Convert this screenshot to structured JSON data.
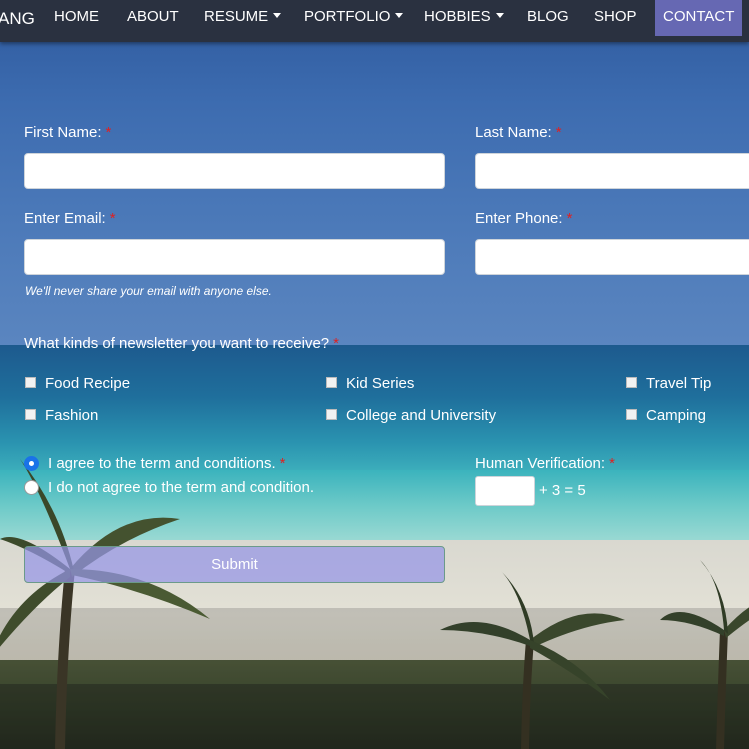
{
  "nav": {
    "brand": "ANG",
    "items": [
      {
        "label": "HOME",
        "dropdown": false,
        "active": false
      },
      {
        "label": "ABOUT",
        "dropdown": false,
        "active": false
      },
      {
        "label": "RESUME",
        "dropdown": true,
        "active": false
      },
      {
        "label": "PORTFOLIO",
        "dropdown": true,
        "active": false
      },
      {
        "label": "HOBBIES",
        "dropdown": true,
        "active": false
      },
      {
        "label": "BLOG",
        "dropdown": false,
        "active": false
      },
      {
        "label": "SHOP",
        "dropdown": false,
        "active": false
      },
      {
        "label": "CONTACT",
        "dropdown": false,
        "active": true
      }
    ],
    "active_color": "#6668b3"
  },
  "form": {
    "first_name": {
      "label": "First Name:",
      "required": "*",
      "value": ""
    },
    "last_name": {
      "label": "Last Name:",
      "required": "*",
      "value": ""
    },
    "email": {
      "label": "Enter Email:",
      "required": "*",
      "value": "",
      "help": "We'll never share your email with anyone else."
    },
    "phone": {
      "label": "Enter Phone:",
      "required": "*",
      "value": ""
    },
    "newsletter": {
      "question": "What kinds of newsletter you want to receive?",
      "required": "*",
      "options": [
        "Food Recipe",
        "Kid Series",
        "Travel Tip",
        "Fashion",
        "College and University",
        "Camping"
      ]
    },
    "terms": {
      "agree": "I agree to the term and conditions.",
      "agree_required": "*",
      "disagree": "I do not agree to the term and condition.",
      "selected": "agree"
    },
    "verification": {
      "label": "Human Verification:",
      "required": "*",
      "value": "",
      "equation": "+ 3 = 5"
    },
    "submit_label": "Submit"
  }
}
